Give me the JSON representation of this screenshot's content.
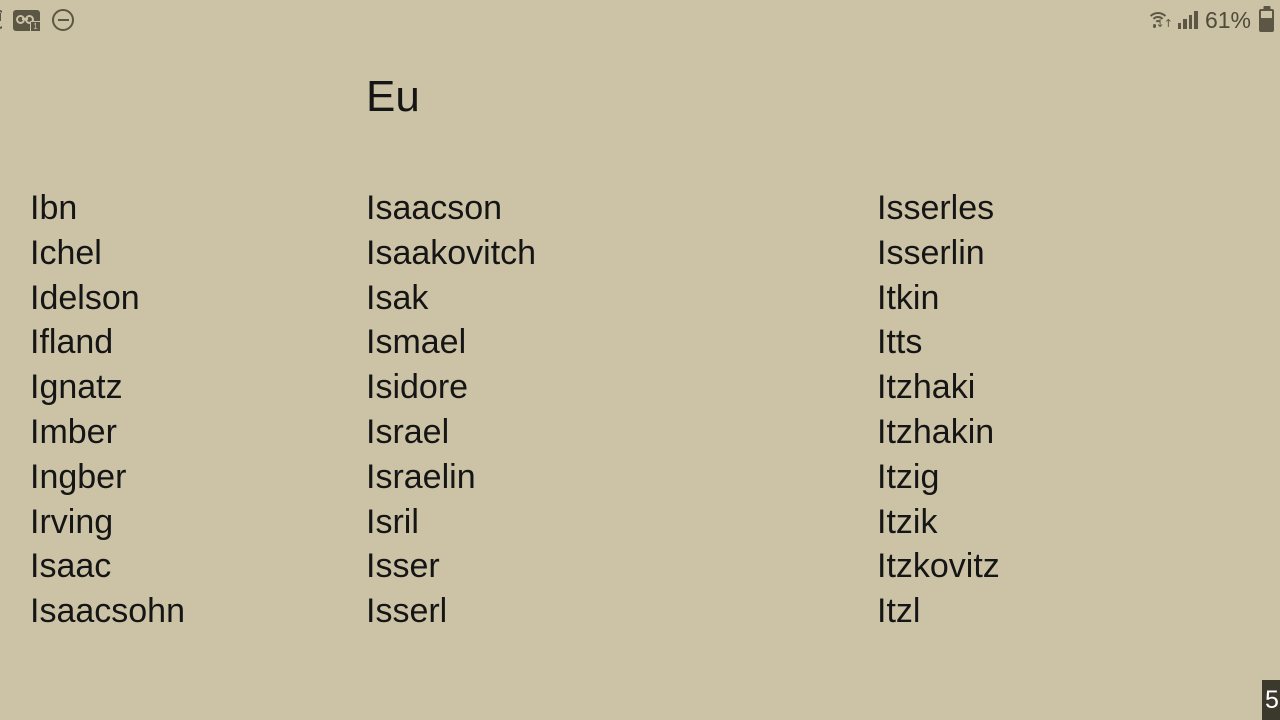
{
  "status_bar": {
    "left_icons": [
      {
        "name": "clipped-circle-icon",
        "label": ""
      },
      {
        "name": "voicemail-icon",
        "badge": "1"
      },
      {
        "name": "do-not-disturb-icon",
        "label": ""
      }
    ],
    "right": {
      "wifi_icon": "wifi-transfer-icon",
      "wifi_arrows": "↓↑",
      "signal_icon": "cellular-signal-icon",
      "battery_percent": "61%",
      "battery_level": 61,
      "battery_icon": "battery-icon"
    }
  },
  "header": {
    "title": "Eu"
  },
  "colors": {
    "background": "#ccc3a6",
    "text": "#151515",
    "status_icon": "#5c5744",
    "badge_background": "#3b382c",
    "badge_text": "#ffffff"
  },
  "columns": [
    {
      "id": "column-1",
      "entries": [
        "Ibn",
        "Ichel",
        "Idelson",
        "Ifland",
        "Ignatz",
        "Imber",
        "Ingber",
        "Irving",
        "Isaac",
        "Isaacsohn"
      ]
    },
    {
      "id": "column-2",
      "entries": [
        "Isaacson",
        "Isaakovitch",
        "Isak",
        "Ismael",
        "Isidore",
        "Israel",
        "Israelin",
        "Isril",
        "Isser",
        "Isserl"
      ]
    },
    {
      "id": "column-3",
      "entries": [
        "Isserles",
        "Isserlin",
        "Itkin",
        "Itts",
        "Itzhaki",
        "Itzhakin",
        "Itzig",
        "Itzik",
        "Itzkovitz",
        "Itzl"
      ]
    }
  ],
  "page_badge": {
    "number": "5"
  }
}
